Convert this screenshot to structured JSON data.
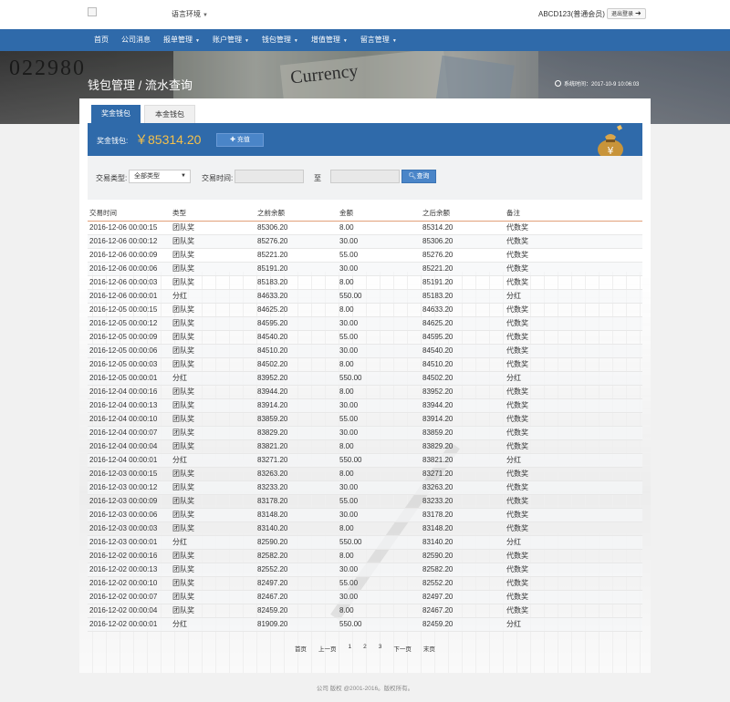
{
  "header": {
    "language_label": "语言环境",
    "user_label": "ABCD123(普通会员)",
    "logout_label": "退出登录"
  },
  "nav": {
    "items": [
      {
        "label": "首页",
        "dropdown": false
      },
      {
        "label": "公司消息",
        "dropdown": false
      },
      {
        "label": "报单管理",
        "dropdown": true
      },
      {
        "label": "账户管理",
        "dropdown": true
      },
      {
        "label": "钱包管理",
        "dropdown": true
      },
      {
        "label": "增值管理",
        "dropdown": true
      },
      {
        "label": "留言管理",
        "dropdown": true
      }
    ]
  },
  "banner": {
    "page_title": "钱包管理 / 流水查询",
    "time_text": "系统时间：2017-10-9 10:06:03",
    "bill_number": "022980",
    "bill_word": "Currency"
  },
  "tabs": [
    {
      "label": "奖金钱包",
      "active": true
    },
    {
      "label": "本金钱包",
      "active": false
    }
  ],
  "wallet": {
    "label": "奖金钱包:",
    "amount": "￥85314.20",
    "recharge_label": "充值"
  },
  "filter": {
    "type_label": "交易类型:",
    "type_value": "全部类型",
    "time_label": "交易时间:",
    "to_label": "至",
    "search_label": "查询"
  },
  "table": {
    "headers": [
      "交易时间",
      "类型",
      "之前余额",
      "金额",
      "之后余额",
      "备注"
    ],
    "rows": [
      [
        "2016-12-06 00:00:15",
        "团队奖",
        "85306.20",
        "8.00",
        "85314.20",
        "代数奖"
      ],
      [
        "2016-12-06 00:00:12",
        "团队奖",
        "85276.20",
        "30.00",
        "85306.20",
        "代数奖"
      ],
      [
        "2016-12-06 00:00:09",
        "团队奖",
        "85221.20",
        "55.00",
        "85276.20",
        "代数奖"
      ],
      [
        "2016-12-06 00:00:06",
        "团队奖",
        "85191.20",
        "30.00",
        "85221.20",
        "代数奖"
      ],
      [
        "2016-12-06 00:00:03",
        "团队奖",
        "85183.20",
        "8.00",
        "85191.20",
        "代数奖"
      ],
      [
        "2016-12-06 00:00:01",
        "分红",
        "84633.20",
        "550.00",
        "85183.20",
        "分红"
      ],
      [
        "2016-12-05 00:00:15",
        "团队奖",
        "84625.20",
        "8.00",
        "84633.20",
        "代数奖"
      ],
      [
        "2016-12-05 00:00:12",
        "团队奖",
        "84595.20",
        "30.00",
        "84625.20",
        "代数奖"
      ],
      [
        "2016-12-05 00:00:09",
        "团队奖",
        "84540.20",
        "55.00",
        "84595.20",
        "代数奖"
      ],
      [
        "2016-12-05 00:00:06",
        "团队奖",
        "84510.20",
        "30.00",
        "84540.20",
        "代数奖"
      ],
      [
        "2016-12-05 00:00:03",
        "团队奖",
        "84502.20",
        "8.00",
        "84510.20",
        "代数奖"
      ],
      [
        "2016-12-05 00:00:01",
        "分红",
        "83952.20",
        "550.00",
        "84502.20",
        "分红"
      ],
      [
        "2016-12-04 00:00:16",
        "团队奖",
        "83944.20",
        "8.00",
        "83952.20",
        "代数奖"
      ],
      [
        "2016-12-04 00:00:13",
        "团队奖",
        "83914.20",
        "30.00",
        "83944.20",
        "代数奖"
      ],
      [
        "2016-12-04 00:00:10",
        "团队奖",
        "83859.20",
        "55.00",
        "83914.20",
        "代数奖"
      ],
      [
        "2016-12-04 00:00:07",
        "团队奖",
        "83829.20",
        "30.00",
        "83859.20",
        "代数奖"
      ],
      [
        "2016-12-04 00:00:04",
        "团队奖",
        "83821.20",
        "8.00",
        "83829.20",
        "代数奖"
      ],
      [
        "2016-12-04 00:00:01",
        "分红",
        "83271.20",
        "550.00",
        "83821.20",
        "分红"
      ],
      [
        "2016-12-03 00:00:15",
        "团队奖",
        "83263.20",
        "8.00",
        "83271.20",
        "代数奖"
      ],
      [
        "2016-12-03 00:00:12",
        "团队奖",
        "83233.20",
        "30.00",
        "83263.20",
        "代数奖"
      ],
      [
        "2016-12-03 00:00:09",
        "团队奖",
        "83178.20",
        "55.00",
        "83233.20",
        "代数奖"
      ],
      [
        "2016-12-03 00:00:06",
        "团队奖",
        "83148.20",
        "30.00",
        "83178.20",
        "代数奖"
      ],
      [
        "2016-12-03 00:00:03",
        "团队奖",
        "83140.20",
        "8.00",
        "83148.20",
        "代数奖"
      ],
      [
        "2016-12-03 00:00:01",
        "分红",
        "82590.20",
        "550.00",
        "83140.20",
        "分红"
      ],
      [
        "2016-12-02 00:00:16",
        "团队奖",
        "82582.20",
        "8.00",
        "82590.20",
        "代数奖"
      ],
      [
        "2016-12-02 00:00:13",
        "团队奖",
        "82552.20",
        "30.00",
        "82582.20",
        "代数奖"
      ],
      [
        "2016-12-02 00:00:10",
        "团队奖",
        "82497.20",
        "55.00",
        "82552.20",
        "代数奖"
      ],
      [
        "2016-12-02 00:00:07",
        "团队奖",
        "82467.20",
        "30.00",
        "82497.20",
        "代数奖"
      ],
      [
        "2016-12-02 00:00:04",
        "团队奖",
        "82459.20",
        "8.00",
        "82467.20",
        "代数奖"
      ],
      [
        "2016-12-02 00:00:01",
        "分红",
        "81909.20",
        "550.00",
        "82459.20",
        "分红"
      ]
    ]
  },
  "pagination": {
    "items": [
      "首页",
      "上一页",
      "1",
      "2",
      "3",
      "下一页",
      "末页"
    ]
  },
  "footer": {
    "text": "公司 版权 @2001-2016。版权所有。"
  },
  "colors": {
    "brand_blue": "#2f6aaa",
    "amount_gold": "#f5c04a",
    "header_rule": "#e2a07a"
  }
}
